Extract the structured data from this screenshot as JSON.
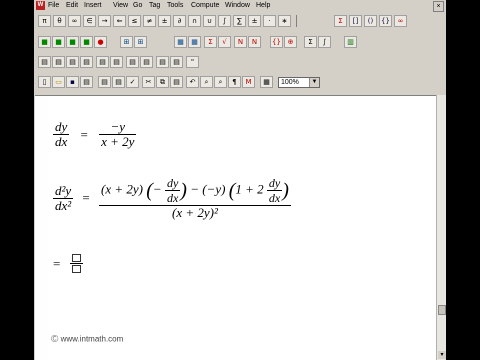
{
  "menu": [
    "File",
    "Edit",
    "Insert",
    "View",
    "Go",
    "Tag",
    "Tools",
    "Compute",
    "Window",
    "Help"
  ],
  "toolbar1": [
    "π",
    "θ",
    "∞",
    "∈",
    "→",
    "⇐",
    "≤",
    "≠",
    "±",
    "∂",
    "∩",
    "∪",
    "∫",
    "∑",
    "±",
    "·",
    "∗"
  ],
  "toolbar1b": [
    "Σ",
    "[]",
    "()",
    "{}",
    "∞"
  ],
  "toolbar2": [
    "Σ",
    "√",
    "N",
    "N",
    "{}",
    "⊕",
    "Σ",
    "∫"
  ],
  "toolbar4_zoom": "100%",
  "equations": {
    "eq1": {
      "lhs_num": "dy",
      "lhs_den": "dx",
      "eq": "=",
      "rhs_num": "−y",
      "rhs_den": "x + 2y"
    },
    "eq2": {
      "lhs_num": "d²y",
      "lhs_den": "dx²",
      "eq": "=",
      "num_part1": "(x + 2y)",
      "num_open": "(",
      "num_minus": "−",
      "num_dy": "dy",
      "num_dx": "dx",
      "num_close": ")",
      "num_mid": " − (−y)",
      "num_open2": "(",
      "num_one": "1 + 2",
      "num_close2": ")",
      "den": "(x + 2y)²"
    },
    "eq3": {
      "eq": "="
    }
  },
  "footer": {
    "copyright": "©",
    "site": "www.intmath.com"
  }
}
